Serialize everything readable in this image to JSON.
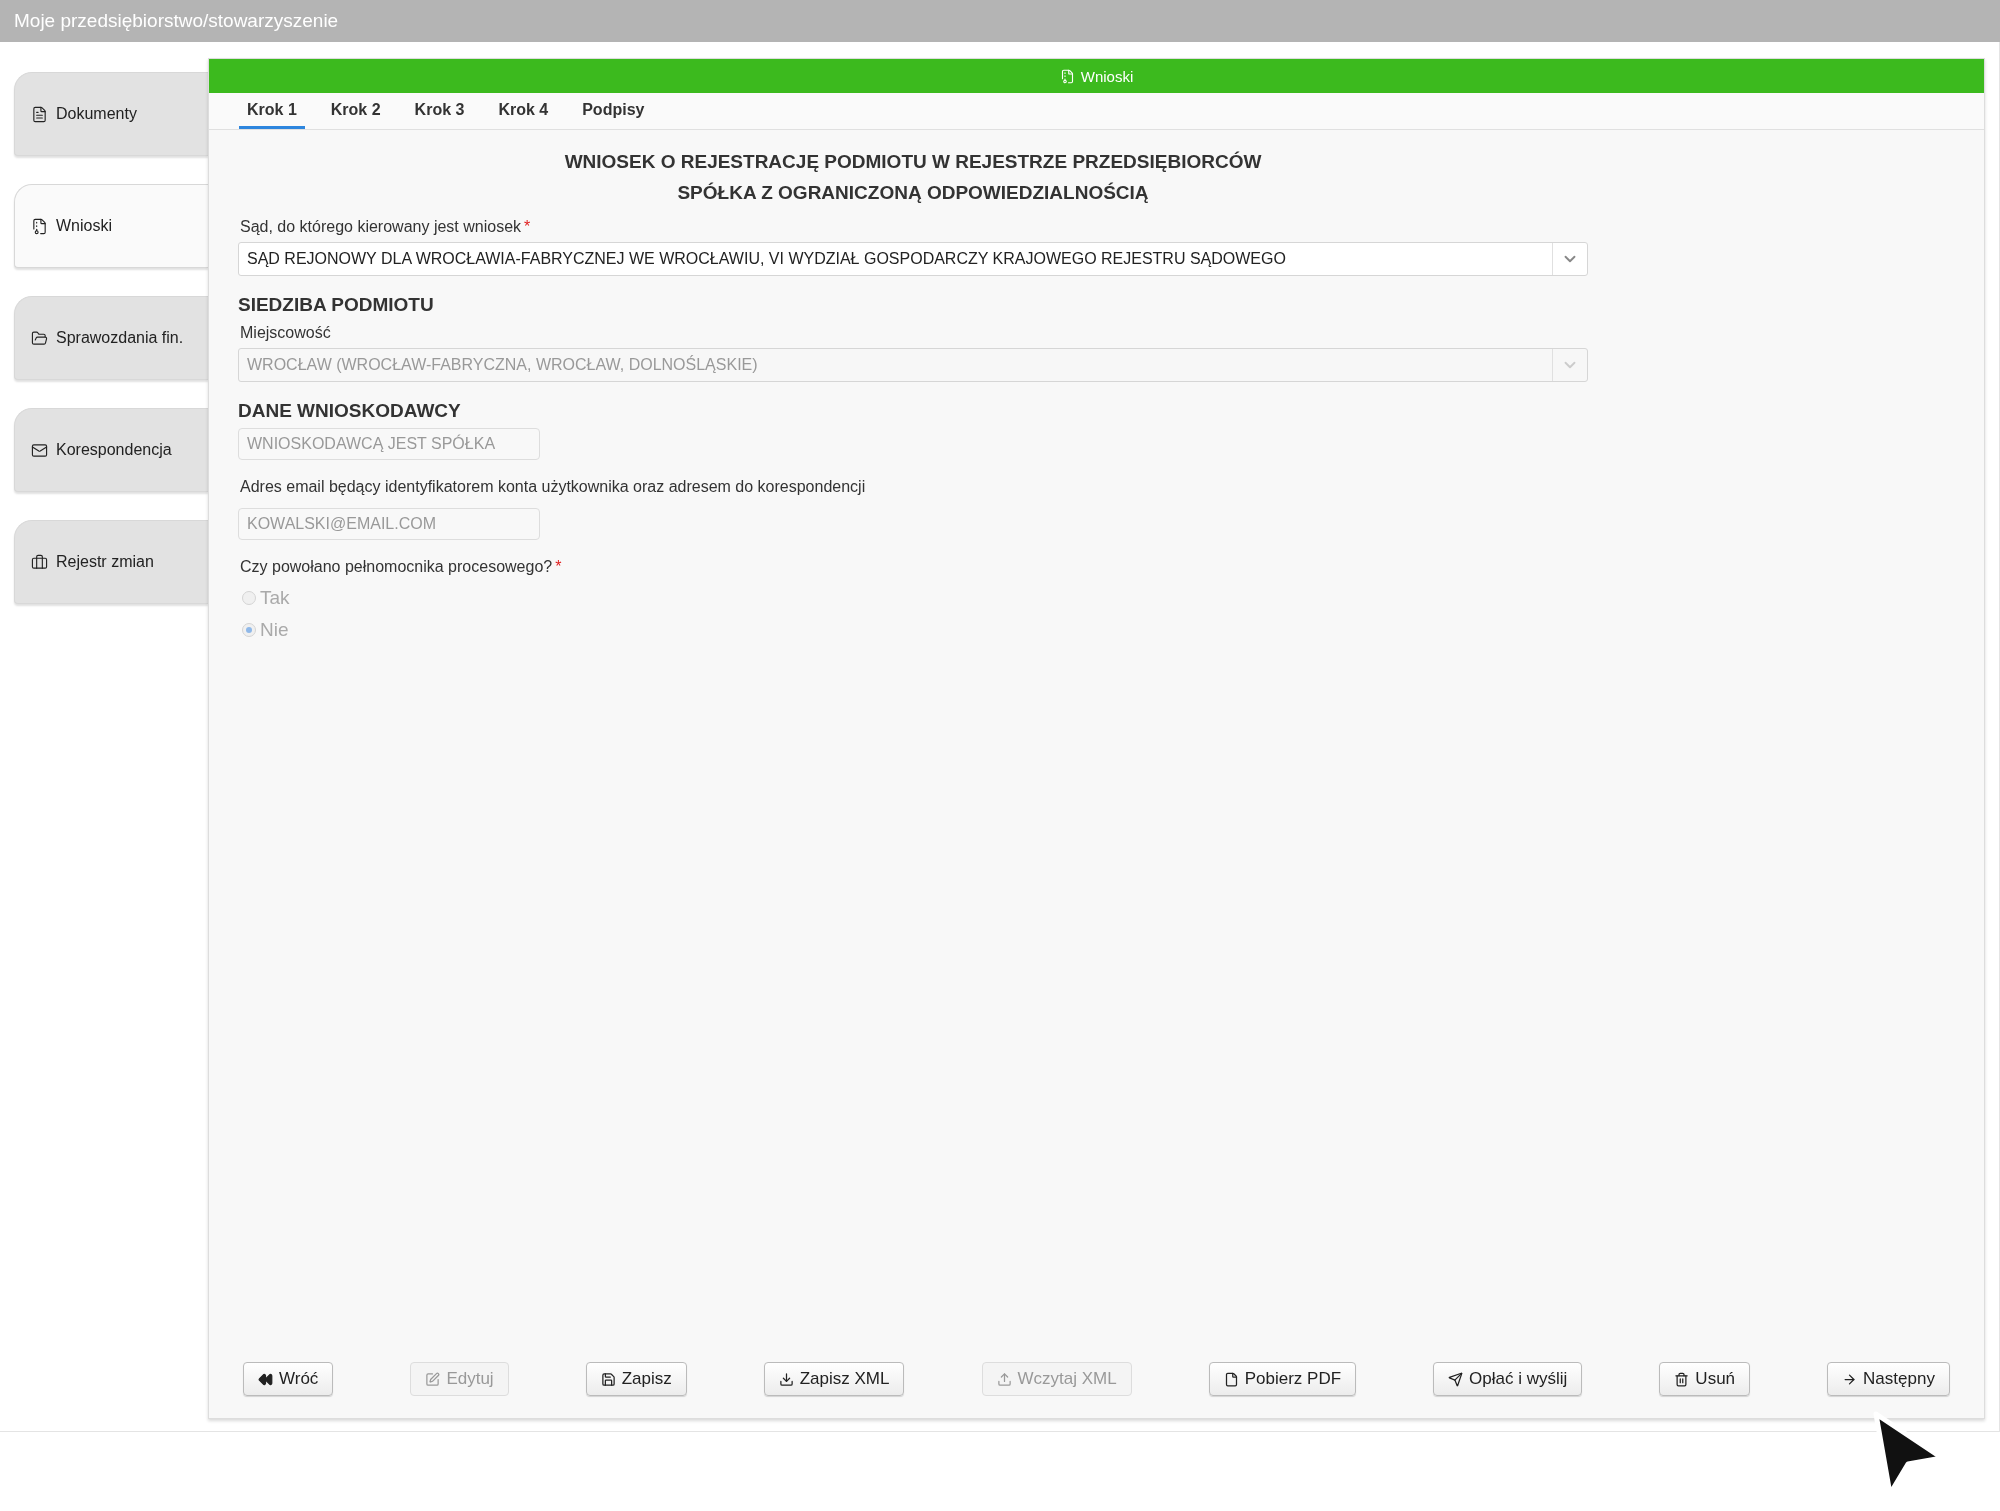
{
  "top_bar": {
    "title": "Moje przedsiębiorstwo/stowarzyszenie"
  },
  "sidebar": {
    "items": [
      {
        "label": "Dokumenty",
        "kind": "document",
        "selected": false
      },
      {
        "label": "Wnioski",
        "kind": "archive",
        "selected": true
      },
      {
        "label": "Sprawozdania fin.",
        "kind": "folder",
        "selected": false
      },
      {
        "label": "Korespondencja",
        "kind": "mail",
        "selected": false
      },
      {
        "label": "Rejestr zmian",
        "kind": "briefcase",
        "selected": false
      }
    ]
  },
  "panel": {
    "title": "Wnioski",
    "tabs": [
      {
        "label": "Krok 1",
        "selected": true
      },
      {
        "label": "Krok 2",
        "selected": false
      },
      {
        "label": "Krok 3",
        "selected": false
      },
      {
        "label": "Krok 4",
        "selected": false
      },
      {
        "label": "Podpisy",
        "selected": false
      }
    ],
    "heading": [
      "WNIOSEK O REJESTRACJĘ PODMIOTU W REJESTRZE PRZEDSIĘBIORCÓW",
      "SPÓŁKA Z OGRANICZONĄ ODPOWIEDZIALNOŚCIĄ"
    ],
    "form": [
      {
        "kind": "select",
        "label": "Sąd, do którego kierowany jest wniosek",
        "required_mark": "*",
        "value": "SĄD REJONOWY  DLA WROCŁAWIA-FABRYCZNEJ WE WROCŁAWIU, VI WYDZIAŁ GOSPODARCZY KRAJOWEGO REJESTRU SĄDOWEGO",
        "disabled": false
      },
      {
        "kind": "section",
        "text": "SIEDZIBA PODMIOTU"
      },
      {
        "kind": "select",
        "label": "Miejscowość",
        "value": "WROCŁAW (WROCŁAW-FABRYCZNA, WROCŁAW, DOLNOŚLĄSKIE)",
        "disabled": true
      },
      {
        "kind": "section",
        "text": "DANE WNIOSKODAWCY"
      },
      {
        "kind": "input",
        "value": "WNIOSKODAWCĄ JEST SPÓŁKA",
        "disabled": true
      },
      {
        "kind": "input",
        "label": "Adres email będący identyfikatorem konta użytkownika oraz adresem do korespondencji",
        "value": "KOWALSKI@EMAIL.COM",
        "disabled": true
      },
      {
        "kind": "radio",
        "label": "Czy powołano pełnomocnika procesowego?",
        "required_mark": "*",
        "disabled": true,
        "options": [
          {
            "label": "Tak",
            "selected": false
          },
          {
            "label": "Nie",
            "selected": true
          }
        ]
      }
    ],
    "buttons": [
      {
        "label": "Wróć",
        "kind": "back",
        "disabled": false
      },
      {
        "label": "Edytuj",
        "kind": "edit",
        "disabled": true
      },
      {
        "label": "Zapisz",
        "kind": "save",
        "disabled": false
      },
      {
        "label": "Zapisz XML",
        "kind": "download",
        "disabled": false
      },
      {
        "label": "Wczytaj XML",
        "kind": "upload",
        "disabled": true
      },
      {
        "label": "Pobierz PDF",
        "kind": "pdf",
        "disabled": false
      },
      {
        "label": "Opłać i wyślij",
        "kind": "send",
        "disabled": false
      },
      {
        "label": "Usuń",
        "kind": "delete",
        "disabled": false
      },
      {
        "label": "Następny",
        "kind": "next",
        "disabled": false
      }
    ]
  }
}
